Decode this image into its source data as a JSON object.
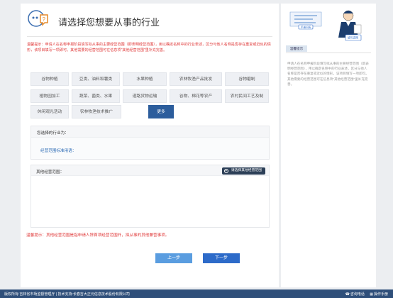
{
  "header": {
    "title": "请选择您想要从事的行业",
    "icon": "question-bubble-icon"
  },
  "warning": "温馨提示：申请人在名称申报阶段填写拟从事的主要经营范围（即表明经营范围），用以确定名称中的行业表述，区分与他人名称是否存在重复或近似的情形，该项目填写一项即可。其他需要的经营范围可在信息项\"其他经营范围\"里补充完善。",
  "categories": [
    {
      "label": "谷物种植"
    },
    {
      "label": "豆类、油料和薯类"
    },
    {
      "label": "水果种植"
    },
    {
      "label": "农林牧渔产品批发"
    },
    {
      "label": "谷物磨制"
    },
    {
      "label": "植物园加工"
    },
    {
      "label": "蔬菜、菌类、水果"
    },
    {
      "label": "道路货物运输"
    },
    {
      "label": "谷物、棉花等农产"
    },
    {
      "label": "农村民间工艺及制"
    },
    {
      "label": "休闲观光活动"
    },
    {
      "label": "农林牧渔技术推广"
    },
    {
      "label": "更多"
    }
  ],
  "selected": {
    "label": "您选择的行业为：",
    "link": "经营范围标准用语："
  },
  "other": {
    "label": "其他经营范围：",
    "button": "请选择其他经营范围"
  },
  "warning2": "温馨提示：其他经营范围是指申请人除首项经营范围外，拟从事的其他兼营事项。",
  "nav": {
    "prev": "上一步",
    "next": "下一步"
  },
  "side": {
    "banner_top": "手册问答",
    "banner_bottom": "填写说明",
    "title": "温馨提示",
    "text": "申请人在名称申报阶段填写拟从事的主要经营范围（即表明经营范围），用以确定名称中的行业表述，区分与他人名称是否存在重复或近似的情形，该项目填写一项即可。其他需要的经营范围可在信息项\"其他经营范围\"里补充完善。"
  },
  "footer": {
    "left": "版权所有:吉林省市场监督管理厅 | 技术支持:长春吉大正元信息技术股份有限公司",
    "phone": "咨询电话",
    "manual": "操作手册"
  },
  "colors": {
    "primary": "#2c5d9c",
    "warning": "#e03a3a",
    "footer": "#2f4f7a",
    "prev_button": "#5a9de0",
    "next_button": "#2d6bc9"
  }
}
